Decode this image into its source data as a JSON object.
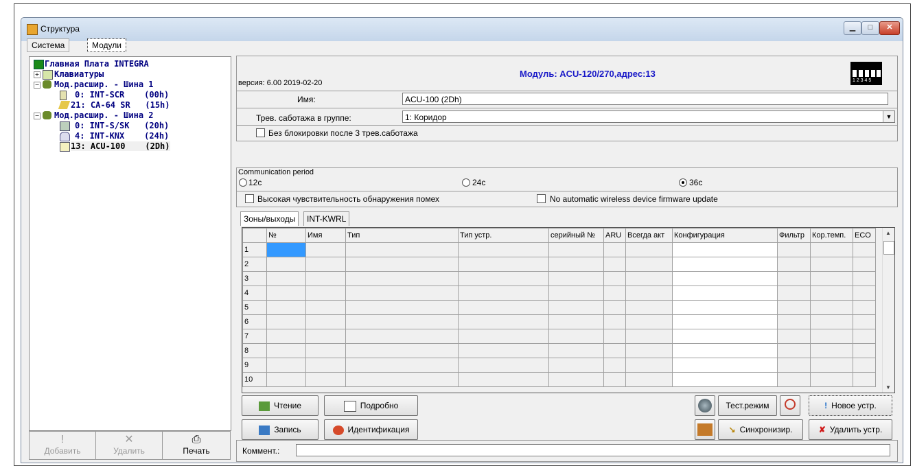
{
  "window": {
    "title": "Структура",
    "min": "▁",
    "max": "□",
    "close": "✕"
  },
  "top_tabs": [
    "Система",
    "Модули"
  ],
  "tree": [
    {
      "text": "Главная Плата INTEGRA"
    },
    {
      "text": "Клавиатуры"
    },
    {
      "text": "Мод.расшир. - Шина 1"
    },
    {
      "text": "0: INT-SCR    (00h)"
    },
    {
      "text": "21: CA-64 SR   (15h)"
    },
    {
      "text": "Мод.расшир. - Шина 2"
    },
    {
      "text": "0: INT-S/SK   (20h)"
    },
    {
      "text": "4: INT-KNX    (24h)"
    },
    {
      "text": "13: ACU-100    (2Dh)"
    }
  ],
  "bottom_buttons": {
    "add": "Добавить",
    "delete": "Удалить",
    "print": "Печать"
  },
  "header": {
    "version": "версия: 6.00 2019-02-20",
    "module": "Модуль: ACU-120/270,адрес:13",
    "dip_numbers": "1 2 3 4 5"
  },
  "name": {
    "label": "Имя:",
    "value": "ACU-100  (2Dh)"
  },
  "tamper": {
    "label": "Трев. саботажа в группе:",
    "value": "1: Коридор"
  },
  "no_block": "Без блокировки после 3 трев.саботажа",
  "comm": {
    "label": "Communication period",
    "opt1": "12c",
    "opt2": "24c",
    "opt3": "36c",
    "selected": "36c"
  },
  "high_sens": "Высокая чувствительность обнаружения помех",
  "no_fw_update": "No automatic wireless device firmware update",
  "inner_tabs": [
    "Зоны/выходы",
    "INT-KWRL"
  ],
  "grid": {
    "headers": [
      "№",
      "Имя",
      "Тип",
      "Тип устр.",
      "серийный №",
      "ARU",
      "Всегда акт",
      "Конфигурация",
      "Фильтр",
      "Кор.темп.",
      "ECO"
    ],
    "rows": [
      "1",
      "2",
      "3",
      "4",
      "5",
      "6",
      "7",
      "8",
      "9",
      "10"
    ]
  },
  "buttons": {
    "read": "Чтение",
    "details": "Подробно",
    "write": "Запись",
    "identify": "Идентификация",
    "test_mode": "Тест.режим",
    "new_device": "Новое устр.",
    "sync": "Синхронизир.",
    "delete_device": "Удалить устр."
  },
  "comment_label": "Коммент.:",
  "comment_value": ""
}
